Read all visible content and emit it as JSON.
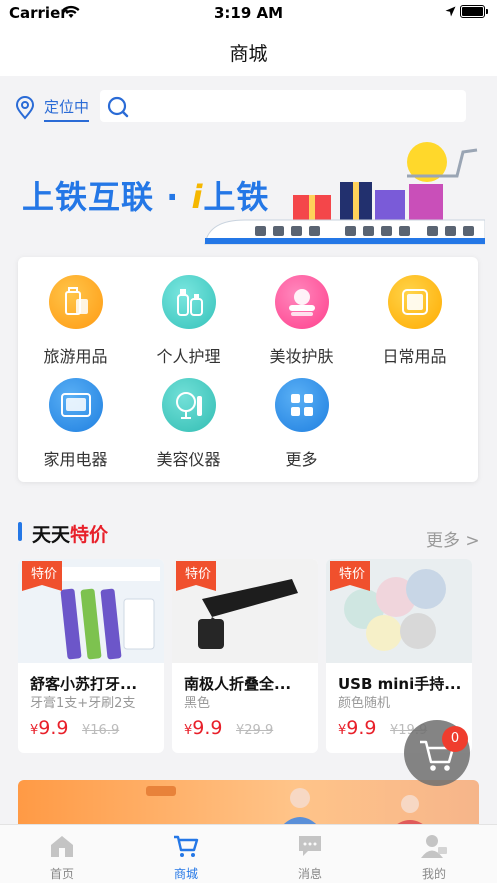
{
  "status_bar": {
    "carrier": "Carrier",
    "time": "3:19 AM"
  },
  "nav": {
    "title": "商城"
  },
  "search": {
    "location_label": "定位中"
  },
  "banner": {
    "title_left": "上铁互联 · ",
    "title_i": "i",
    "title_right": "上铁"
  },
  "categories": [
    {
      "label": "旅游用品",
      "icon": "luggage-icon",
      "color": "#ffa21b"
    },
    {
      "label": "个人护理",
      "icon": "skincare-bottles-icon",
      "color": "#4ecfc8"
    },
    {
      "label": "美妆护肤",
      "icon": "cosmetics-icon",
      "color": "#ff5aa0"
    },
    {
      "label": "日常用品",
      "icon": "towel-icon",
      "color": "#ffb700"
    },
    {
      "label": "家用电器",
      "icon": "microwave-icon",
      "color": "#2f93ea"
    },
    {
      "label": "美容仪器",
      "icon": "beauty-device-icon",
      "color": "#44c9c0"
    },
    {
      "label": "更多",
      "icon": "grid-more-icon",
      "color": "#2f93ea"
    }
  ],
  "section": {
    "title_a": "天天",
    "title_b": "特价",
    "more": "更多 >"
  },
  "products": [
    {
      "tag": "特价",
      "name": "舒客小苏打牙...",
      "sub": "牙膏1支+牙刷2支",
      "currency": "¥",
      "price": "9.9",
      "old_price": "¥16.9"
    },
    {
      "tag": "特价",
      "name": "南极人折叠全...",
      "sub": "黑色",
      "currency": "¥",
      "price": "9.9",
      "old_price": "¥29.9"
    },
    {
      "tag": "特价",
      "name": "USB mini手持...",
      "sub": "颜色随机",
      "currency": "¥",
      "price": "9.9",
      "old_price": "¥19.9"
    }
  ],
  "cart": {
    "count": "0"
  },
  "tabs": [
    {
      "label": "首页",
      "icon": "home-icon"
    },
    {
      "label": "商城",
      "icon": "shopping-cart-icon"
    },
    {
      "label": "消息",
      "icon": "message-icon"
    },
    {
      "label": "我的",
      "icon": "user-icon"
    }
  ],
  "colors": {
    "accent": "#2477e6",
    "price_red": "#e8202a",
    "badge": "#ef3d2e"
  }
}
